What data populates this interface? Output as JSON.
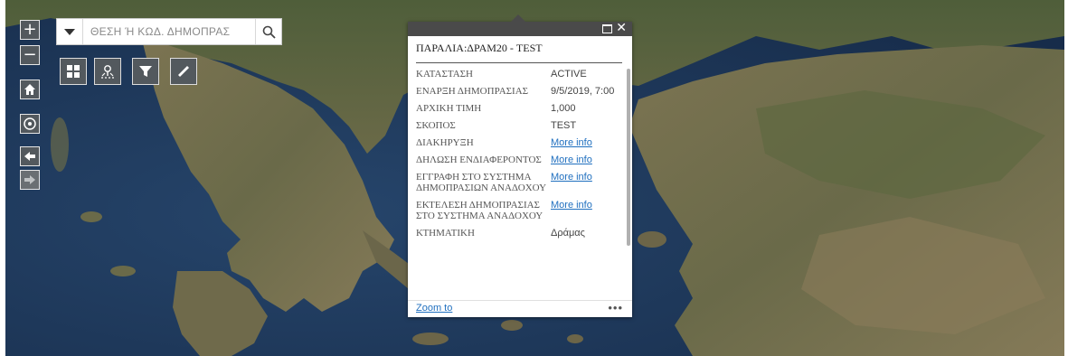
{
  "nav": {
    "zoom_in": "+",
    "zoom_out": "−",
    "home_icon": "home-icon",
    "locate_icon": "locate-icon",
    "back_icon": "arrow-left-icon",
    "forward_icon": "arrow-right-icon"
  },
  "search": {
    "placeholder": "ΘΕΣΗ Ή ΚΩΔ. ΔΗΜΟΠΡΑΣ",
    "icon": "search-icon"
  },
  "toolbar": [
    "grid-icon",
    "location-pin-icon",
    "filter-icon",
    "ruler-icon"
  ],
  "popup": {
    "title": "ΠΑΡΑΛΙΑ:ΔΡΑΜ20 - TEST",
    "rows": [
      {
        "key": "ΚΑΤΑΣΤΑΣΗ",
        "value": "ACTIVE"
      },
      {
        "key": "ΕΝΑΡΞΗ ΔΗΜΟΠΡΑΣΙΑΣ",
        "value": "9/5/2019, 7:00"
      },
      {
        "key": "ΑΡΧΙΚΗ ΤΙΜΗ",
        "value": "1,000"
      },
      {
        "key": "ΣΚΟΠΟΣ",
        "value": "TEST"
      },
      {
        "key": "ΔΙΑΚΗΡΥΞΗ",
        "value": "More info"
      },
      {
        "key": "ΔΗΛΩΣΗ ΕΝΔΙΑΦΕΡΟΝΤΟΣ",
        "value": "More info"
      },
      {
        "key": "ΕΓΓΡΑΦΗ ΣΤΟ ΣΥΣΤΗΜΑ ΔΗΜΟΠΡΑΣΙΩΝ ΑΝΑΔΟΧΟΥ",
        "value": "More info"
      },
      {
        "key": "ΕΚΤΕΛΕΣΗ ΔΗΜΟΠΡΑΣΙΑΣ ΣΤΟ ΣΥΣΤΗΜΑ ΑΝΑΔΟΧΟΥ",
        "value": "More info"
      },
      {
        "key": "ΚΤΗΜΑΤΙΚΗ",
        "value": "Δράμας"
      }
    ],
    "zoom_to": "Zoom to",
    "more": "•••"
  },
  "colors": {
    "sea": "#1b3657",
    "land": "#6e6a4e",
    "panel": "#53595e"
  }
}
